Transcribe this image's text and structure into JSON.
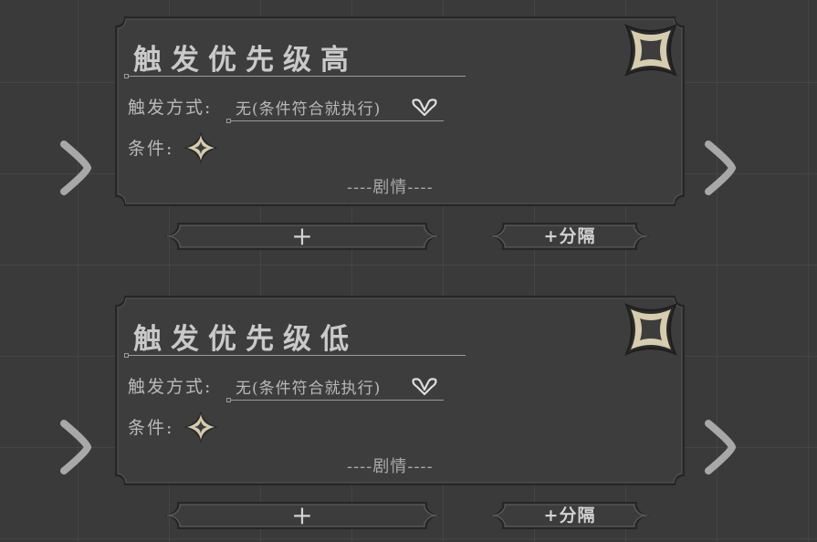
{
  "nodes": [
    {
      "title": "触发优先级高",
      "trigger_label": "触发方式:",
      "trigger_value": "无(条件符合就执行)",
      "condition_label": "条件:",
      "story_label": "----剧情----",
      "add_label": "+",
      "split_label": "+分隔"
    },
    {
      "title": "触发优先级低",
      "trigger_label": "触发方式:",
      "trigger_value": "无(条件符合就执行)",
      "condition_label": "条件:",
      "story_label": "----剧情----",
      "add_label": "+",
      "split_label": "+分隔"
    }
  ],
  "icons": {
    "nav_left": "chevron-right-icon",
    "nav_right": "chevron-right-icon",
    "corner": "concave-square-icon",
    "dropdown": "heart-chevron-icon",
    "condition": "four-point-star-icon"
  },
  "colors": {
    "background": "#3a3a3a",
    "card": "#3d3d3d",
    "card_border": "#262626",
    "text": "#b9b9b9",
    "title_text": "#c9c9c9",
    "icon_fill": "#d6ccae",
    "arrow": "#a8a8a8",
    "button_fill": "#3c3c3c"
  }
}
